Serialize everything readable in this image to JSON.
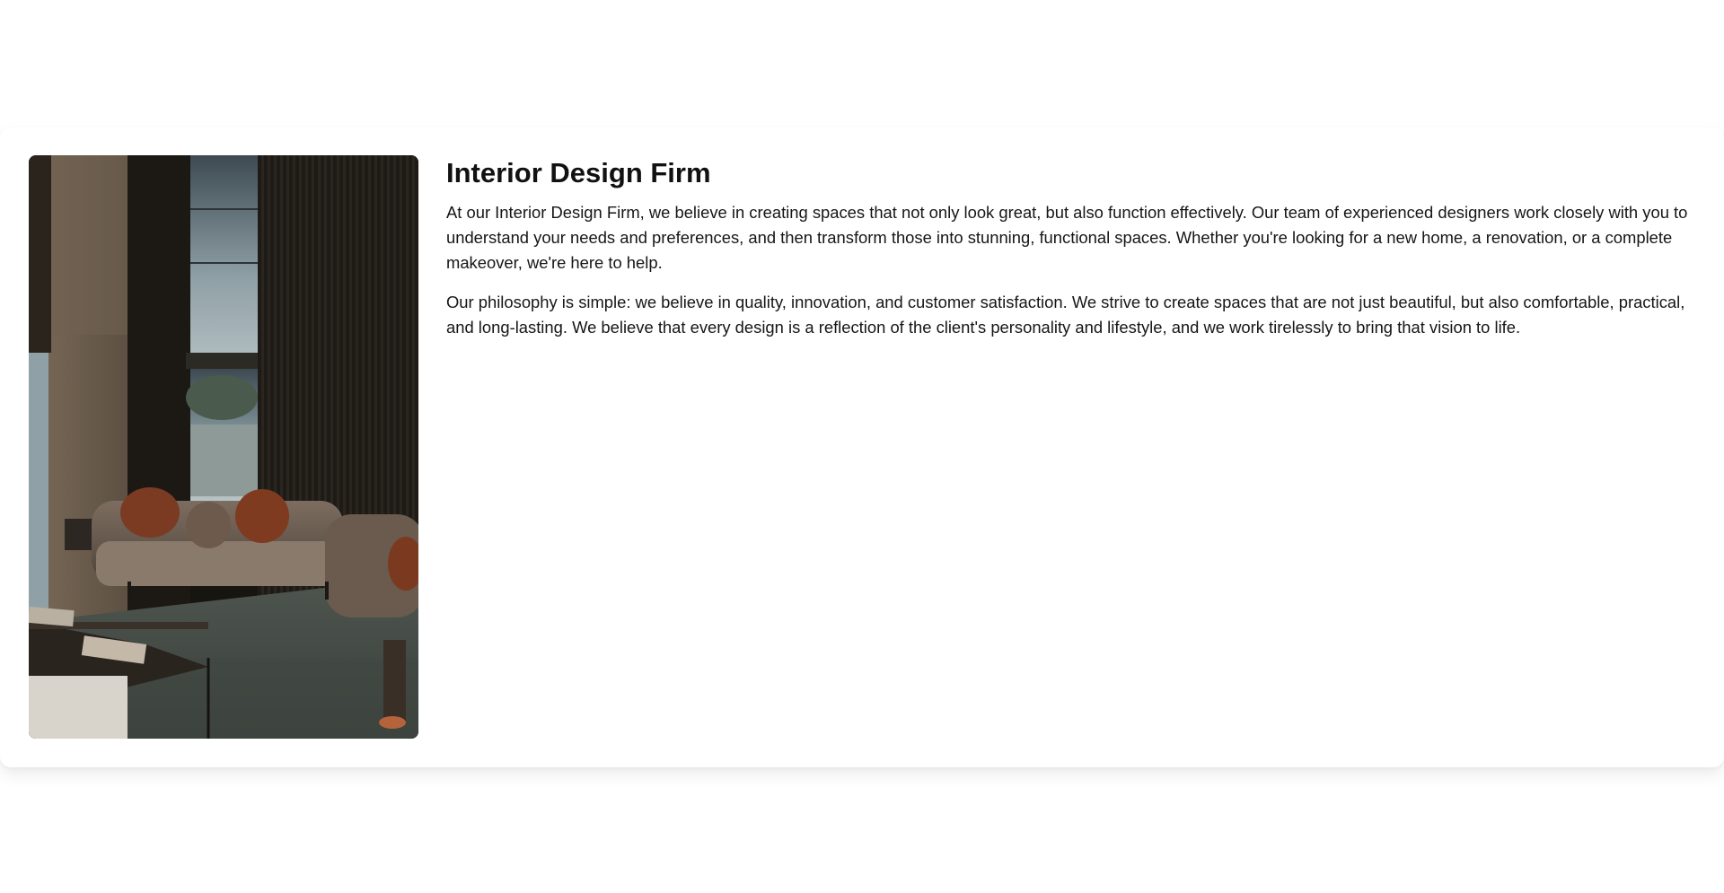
{
  "section": {
    "image": {
      "alt": "Modern living room interior with sofa and tall windows",
      "icon": "interior-photo"
    },
    "title": "Interior Design Firm",
    "paragraphs": [
      "At our Interior Design Firm, we believe in creating spaces that not only look great, but also function effectively. Our team of experienced designers work closely with you to understand your needs and preferences, and then transform those into stunning, functional spaces. Whether you're looking for a new home, a renovation, or a complete makeover, we're here to help.",
      "Our philosophy is simple: we believe in quality, innovation, and customer satisfaction. We strive to create spaces that are not just beautiful, but also comfortable, practical, and long-lasting. We believe that every design is a reflection of the client's personality and lifestyle, and we work tirelessly to bring that vision to life."
    ]
  }
}
